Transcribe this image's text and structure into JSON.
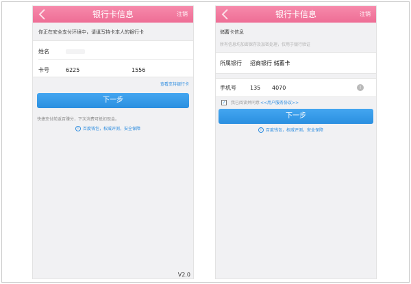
{
  "colors": {
    "nav_pink": "#f2799e",
    "button_blue": "#2e97e8",
    "link_blue": "#2f8ee0",
    "page_bg": "#f1f1f3"
  },
  "screen1": {
    "nav_title": "银行卡信息",
    "nav_action": "注销",
    "notice": "你正在安全支付环境中，请填写持卡本人的银行卡",
    "name_label": "姓名",
    "card_label": "卡号",
    "card_prefix": "6225",
    "card_suffix": "1556",
    "supported_banks_link": "查看支持银行卡",
    "next_button": "下一步",
    "promo": "快捷支付前返百赚分，下次消费可抵扣现金。",
    "security_note": "百度钱包，权威评测，安全保障",
    "version": "V2.0"
  },
  "screen2": {
    "nav_title": "银行卡信息",
    "nav_action": "注销",
    "section_title": "储蓄卡信息",
    "section_desc": "所有信息均加密保存及加密处理，仅用于银行验证",
    "bank_label": "所属银行",
    "bank_value": "招商银行 储蓄卡",
    "phone_label": "手机号",
    "phone_prefix": "135",
    "phone_suffix": "4070",
    "agree_text": "我已阅读并同意",
    "agreement_link": "<<用户服务协议>>",
    "next_button": "下一步",
    "security_note": "百度钱包，权威评测，安全保障"
  }
}
